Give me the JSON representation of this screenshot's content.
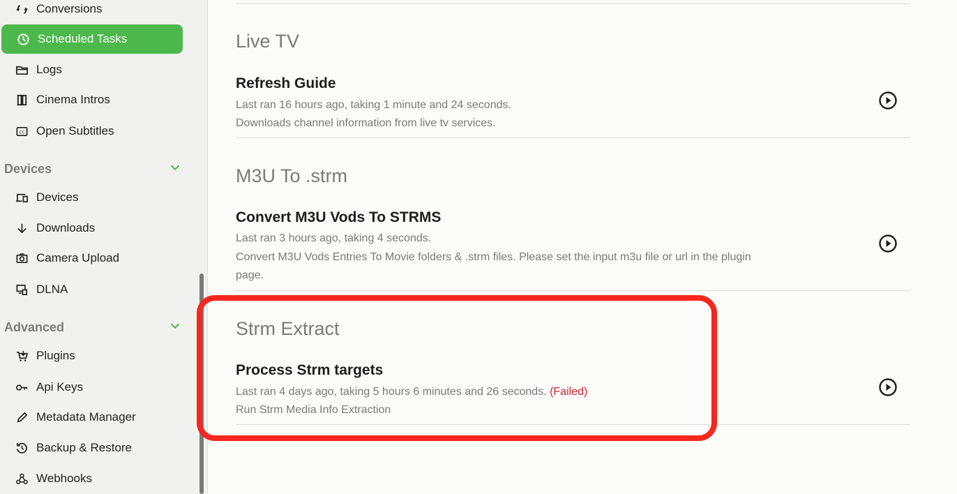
{
  "sidebar": {
    "items_top": [
      {
        "label": "Conversions",
        "icon": "conversions-icon"
      },
      {
        "label": "Scheduled Tasks",
        "icon": "clock-icon",
        "active": true
      },
      {
        "label": "Logs",
        "icon": "folder-icon"
      },
      {
        "label": "Cinema Intros",
        "icon": "film-icon"
      },
      {
        "label": "Open Subtitles",
        "icon": "cc-icon"
      }
    ],
    "devices_section": {
      "title": "Devices",
      "items": [
        {
          "label": "Devices",
          "icon": "devices-icon"
        },
        {
          "label": "Downloads",
          "icon": "download-arrow-icon"
        },
        {
          "label": "Camera Upload",
          "icon": "camera-icon"
        },
        {
          "label": "DLNA",
          "icon": "dlna-icon"
        }
      ]
    },
    "advanced_section": {
      "title": "Advanced",
      "items": [
        {
          "label": "Plugins",
          "icon": "cart-icon"
        },
        {
          "label": "Api Keys",
          "icon": "key-icon"
        },
        {
          "label": "Metadata Manager",
          "icon": "pencil-icon"
        },
        {
          "label": "Backup & Restore",
          "icon": "restore-icon"
        },
        {
          "label": "Webhooks",
          "icon": "webhook-icon"
        }
      ]
    }
  },
  "groups": [
    {
      "title": "Live TV",
      "task": {
        "name": "Refresh Guide",
        "last_ran": "Last ran 16 hours ago, taking 1 minute and 24 seconds.",
        "description": "Downloads channel information from live tv services."
      }
    },
    {
      "title": "M3U To .strm",
      "task": {
        "name": "Convert M3U Vods To STRMS",
        "last_ran": "Last ran 3 hours ago, taking 4 seconds.",
        "description_line1": "Convert M3U Vods Entries To Movie folders & .strm files. Please set the input m3u file or url in the plugin",
        "description_line2": "page."
      }
    },
    {
      "title": "Strm Extract",
      "task": {
        "name": "Process Strm targets",
        "last_ran": "Last ran 4 days ago, taking 5 hours 6 minutes and 26 seconds.",
        "status": "(Failed)",
        "description": "Run Strm Media Info Extraction"
      }
    }
  ],
  "colors": {
    "accent": "#4cb84b",
    "failed": "#d8232a",
    "highlight": "#f5271e"
  }
}
